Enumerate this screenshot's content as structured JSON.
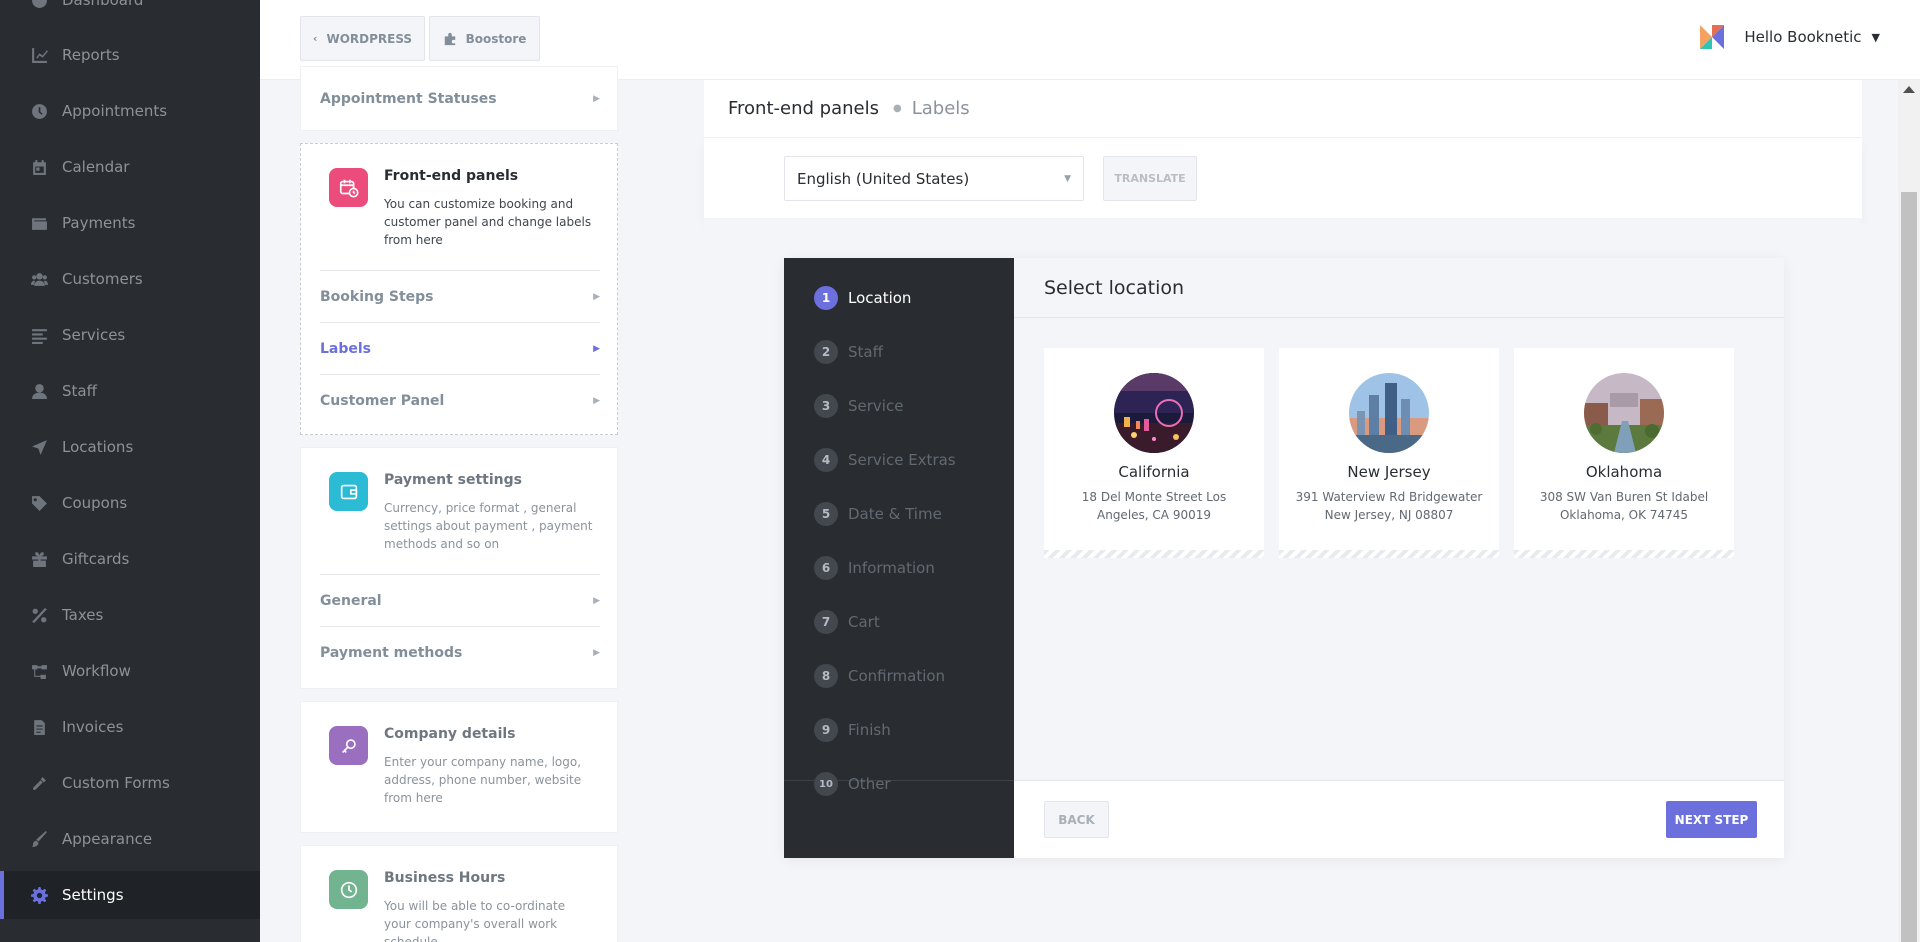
{
  "sidebar": {
    "items": [
      {
        "label": "Dashboard",
        "icon": "dashboard-icon"
      },
      {
        "label": "Reports",
        "icon": "chart-icon"
      },
      {
        "label": "Appointments",
        "icon": "clock-icon"
      },
      {
        "label": "Calendar",
        "icon": "calendar-icon"
      },
      {
        "label": "Payments",
        "icon": "wallet-icon"
      },
      {
        "label": "Customers",
        "icon": "users-icon"
      },
      {
        "label": "Services",
        "icon": "list-icon"
      },
      {
        "label": "Staff",
        "icon": "user-icon"
      },
      {
        "label": "Locations",
        "icon": "location-arrow-icon"
      },
      {
        "label": "Coupons",
        "icon": "tag-icon"
      },
      {
        "label": "Giftcards",
        "icon": "gift-icon"
      },
      {
        "label": "Taxes",
        "icon": "percent-icon"
      },
      {
        "label": "Workflow",
        "icon": "workflow-icon"
      },
      {
        "label": "Invoices",
        "icon": "invoice-icon"
      },
      {
        "label": "Custom Forms",
        "icon": "tools-icon"
      },
      {
        "label": "Appearance",
        "icon": "brush-icon"
      },
      {
        "label": "Settings",
        "icon": "gear-icon",
        "active": true
      }
    ]
  },
  "topbar": {
    "wordpress": "WORDPRESS",
    "boostore": "Boostore",
    "greeting": "Hello Booknetic"
  },
  "settings": {
    "appointment_statuses": "Appointment Statuses",
    "frontend": {
      "title": "Front-end panels",
      "desc": "You can customize booking and customer panel and change labels from here",
      "links": [
        "Booking Steps",
        "Labels",
        "Customer Panel"
      ]
    },
    "payment": {
      "title": "Payment settings",
      "desc": "Currency, price format , general settings about payment , payment methods and so on",
      "links": [
        "General",
        "Payment methods"
      ]
    },
    "company": {
      "title": "Company details",
      "desc": "Enter your company name, logo, address, phone number, website from here"
    },
    "hours": {
      "title": "Business Hours",
      "desc": "You will be able to co-ordinate your company's overall work schedule"
    }
  },
  "panel": {
    "title": "Front-end panels",
    "subtitle": "Labels",
    "language": "English (United States)",
    "translate": "TRANSLATE"
  },
  "booking": {
    "steps": [
      {
        "num": "1",
        "label": "Location"
      },
      {
        "num": "2",
        "label": "Staff"
      },
      {
        "num": "3",
        "label": "Service"
      },
      {
        "num": "4",
        "label": "Service Extras"
      },
      {
        "num": "5",
        "label": "Date & Time"
      },
      {
        "num": "6",
        "label": "Information"
      },
      {
        "num": "7",
        "label": "Cart"
      },
      {
        "num": "8",
        "label": "Confirmation"
      },
      {
        "num": "9",
        "label": "Finish"
      },
      {
        "num": "10",
        "label": "Other"
      }
    ],
    "heading": "Select location",
    "locations": [
      {
        "name": "California",
        "address": "18 Del Monte Street Los Angeles, CA 90019"
      },
      {
        "name": "New Jersey",
        "address": "391 Waterview Rd Bridgewater New Jersey, NJ 08807"
      },
      {
        "name": "Oklahoma",
        "address": "308 SW Van Buren St Idabel Oklahoma, OK 74745"
      }
    ],
    "back": "BACK",
    "next": "NEXT STEP"
  },
  "colors": {
    "accent": "#6c70dc",
    "sidebar": "#292d32"
  }
}
